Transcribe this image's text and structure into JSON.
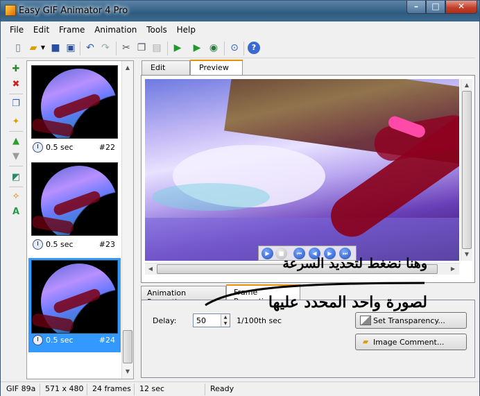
{
  "window": {
    "title": "Easy GIF Animator 4 Pro"
  },
  "menu": [
    "File",
    "Edit",
    "Frame",
    "Animation",
    "Tools",
    "Help"
  ],
  "toolbar": {
    "icons": [
      "new-file-icon",
      "open-folder-icon",
      "dropdown-arrow-icon",
      "save-icon",
      "save-all-icon",
      "undo-icon",
      "redo-icon",
      "cut-icon",
      "copy-icon",
      "paste-icon",
      "play-icon",
      "play-step-icon",
      "preview-in-browser-icon",
      "zoom-icon",
      "help-icon"
    ]
  },
  "sidetools": {
    "icons": [
      "add-frame-icon",
      "delete-frame-icon",
      "duplicate-frame-icon",
      "new-frame-icon",
      "move-up-icon",
      "move-down-icon",
      "resize-icon",
      "wizard-icon",
      "text-icon"
    ]
  },
  "frames": [
    {
      "delay": "0.5 sec",
      "number": "#22",
      "selected": false
    },
    {
      "delay": "0.5 sec",
      "number": "#23",
      "selected": false
    },
    {
      "delay": "0.5 sec",
      "number": "#24",
      "selected": true
    }
  ],
  "tabs": {
    "edit": "Edit",
    "preview": "Preview"
  },
  "props_tabs": {
    "animation": "Animation Properties",
    "frame": "Frame Properties"
  },
  "frame_props": {
    "delay_label": "Delay:",
    "delay_value": "50",
    "delay_unit": "1/100th sec",
    "set_transparency": "Set Transparency...",
    "image_comment": "Image Comment..."
  },
  "annotations": {
    "line1": "وهنا نضغط لتحديد السرعة",
    "line2": "لصورة واحد المحدد عليها"
  },
  "status": {
    "format": "GIF 89a",
    "size": "571 x 480",
    "frames": "24 frames",
    "duration": "12 sec",
    "state": "Ready"
  },
  "colors": {
    "selection": "#3399ff",
    "active_tab_accent": "#e69500",
    "titlebar": "#2f5b80"
  }
}
